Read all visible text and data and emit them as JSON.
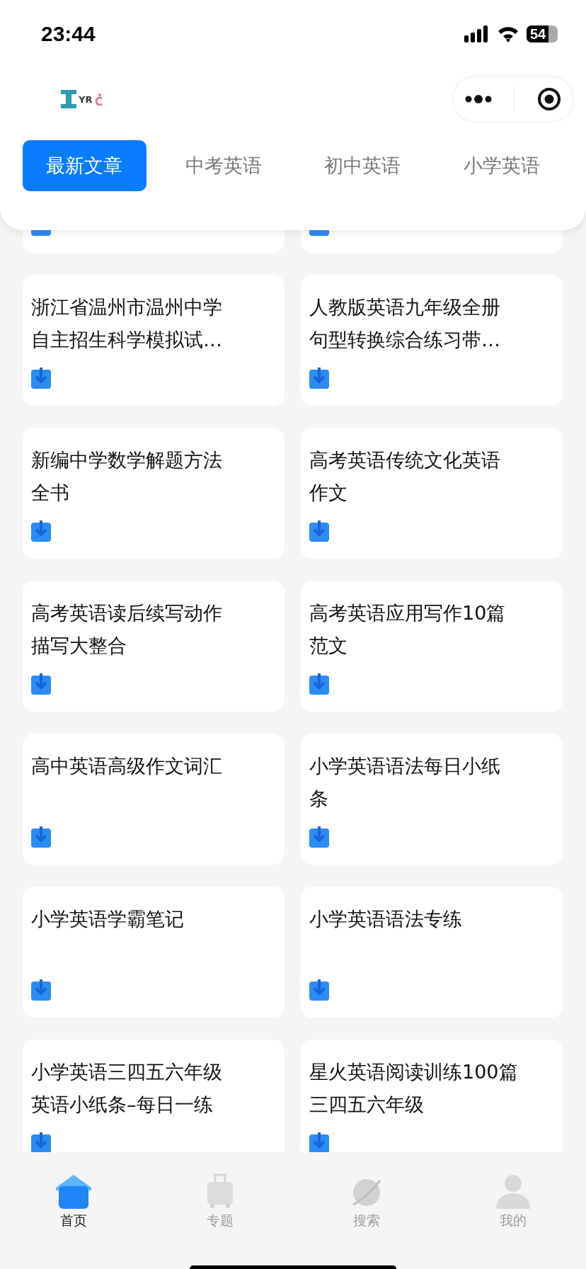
{
  "status_bar": {
    "time": "23:44",
    "battery": "54"
  },
  "header": {
    "logo_text": "YR"
  },
  "tabs": [
    {
      "label": "最新文章",
      "selected": true
    },
    {
      "label": "中考英语",
      "selected": false
    },
    {
      "label": "初中英语",
      "selected": false
    },
    {
      "label": "小学英语",
      "selected": false
    }
  ],
  "articles": [
    {
      "kind": "clipped"
    },
    {
      "kind": "clipped"
    },
    {
      "kind": "card",
      "title": "浙江省温州市温州中学自主招生科学模拟试…"
    },
    {
      "kind": "card",
      "title": "人教版英语九年级全册句型转换综合练习带…"
    },
    {
      "kind": "card",
      "title": "新编中学数学解题方法全书"
    },
    {
      "kind": "card",
      "title": "高考英语传统文化英语作文"
    },
    {
      "kind": "card",
      "title": "高考英语读后续写动作描写大整合"
    },
    {
      "kind": "card",
      "title": "高考英语应用写作10篇范文"
    },
    {
      "kind": "card",
      "title": "高中英语高级作文词汇"
    },
    {
      "kind": "card",
      "title": "小学英语语法每日小纸条"
    },
    {
      "kind": "card",
      "title": "小学英语学霸笔记"
    },
    {
      "kind": "card",
      "title": "小学英语语法专练"
    },
    {
      "kind": "card",
      "title": "小学英语三四五六年级英语小纸条–每日一练"
    },
    {
      "kind": "card",
      "title": "星火英语阅读训练100篇三四五六年级"
    }
  ],
  "bottom_nav": [
    {
      "label": "首页",
      "selected": true,
      "kind": "home"
    },
    {
      "label": "专题",
      "selected": false,
      "kind": "suitcase"
    },
    {
      "label": "搜索",
      "selected": false,
      "kind": "planet"
    },
    {
      "label": "我的",
      "selected": false,
      "kind": "person"
    }
  ]
}
